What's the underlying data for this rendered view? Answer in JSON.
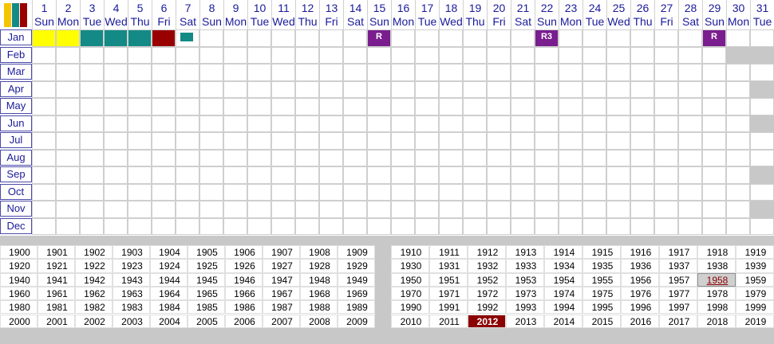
{
  "header": {
    "days": [
      "1",
      "2",
      "3",
      "4",
      "5",
      "6",
      "7",
      "8",
      "9",
      "10",
      "11",
      "12",
      "13",
      "14",
      "15",
      "16",
      "17",
      "18",
      "19",
      "20",
      "21",
      "22",
      "23",
      "24",
      "25",
      "26",
      "27",
      "28",
      "29",
      "30",
      "31"
    ],
    "weekdays": [
      "Sun",
      "Mon",
      "Tue",
      "Wed",
      "Thu",
      "Fri",
      "Sat",
      "Sun",
      "Mon",
      "Tue",
      "Wed",
      "Thu",
      "Fri",
      "Sat",
      "Sun",
      "Mon",
      "Tue",
      "Wed",
      "Thu",
      "Fri",
      "Sat",
      "Sun",
      "Mon",
      "Tue",
      "Wed",
      "Thu",
      "Fri",
      "Sat",
      "Sun",
      "Mon",
      "Tue"
    ]
  },
  "months": [
    "Jan",
    "Feb",
    "Mar",
    "Apr",
    "May",
    "Jun",
    "Jul",
    "Aug",
    "Sep",
    "Oct",
    "Nov",
    "Dec"
  ],
  "colors": {
    "yellow": "#ffff00",
    "teal": "#138a86",
    "darkred": "#990000",
    "purple": "#7a1d8f",
    "label_blue": "#1a1a9a",
    "selected_year_bg": "#8b0000"
  },
  "jan_events": [
    {
      "day": 1,
      "color": "yellow"
    },
    {
      "day": 2,
      "color": "yellow"
    },
    {
      "day": 3,
      "color": "teal"
    },
    {
      "day": 4,
      "color": "teal"
    },
    {
      "day": 5,
      "color": "teal"
    },
    {
      "day": 6,
      "color": "darkred"
    },
    {
      "day": 7,
      "color": "teal",
      "small": true
    }
  ],
  "badges": [
    {
      "day": 15,
      "text": "R"
    },
    {
      "day": 22,
      "text": "R3"
    },
    {
      "day": 29,
      "text": "R"
    }
  ],
  "years_left": [
    [
      "1900",
      "1901",
      "1902",
      "1903",
      "1904",
      "1905",
      "1906",
      "1907",
      "1908",
      "1909"
    ],
    [
      "1920",
      "1921",
      "1922",
      "1923",
      "1924",
      "1925",
      "1926",
      "1927",
      "1928",
      "1929"
    ],
    [
      "1940",
      "1941",
      "1942",
      "1943",
      "1944",
      "1945",
      "1946",
      "1947",
      "1948",
      "1949"
    ],
    [
      "1960",
      "1961",
      "1962",
      "1963",
      "1964",
      "1965",
      "1966",
      "1967",
      "1968",
      "1969"
    ],
    [
      "1980",
      "1981",
      "1982",
      "1983",
      "1984",
      "1985",
      "1986",
      "1987",
      "1988",
      "1989"
    ],
    [
      "2000",
      "2001",
      "2002",
      "2003",
      "2004",
      "2005",
      "2006",
      "2007",
      "2008",
      "2009"
    ]
  ],
  "years_right": [
    [
      "1910",
      "1911",
      "1912",
      "1913",
      "1914",
      "1915",
      "1916",
      "1917",
      "1918",
      "1919"
    ],
    [
      "1930",
      "1931",
      "1932",
      "1933",
      "1934",
      "1935",
      "1936",
      "1937",
      "1938",
      "1939"
    ],
    [
      "1950",
      "1951",
      "1952",
      "1953",
      "1954",
      "1955",
      "1956",
      "1957",
      "1958",
      "1959"
    ],
    [
      "1970",
      "1971",
      "1972",
      "1973",
      "1974",
      "1975",
      "1976",
      "1977",
      "1978",
      "1979"
    ],
    [
      "1990",
      "1991",
      "1992",
      "1993",
      "1994",
      "1995",
      "1996",
      "1997",
      "1998",
      "1999"
    ],
    [
      "2010",
      "2011",
      "2012",
      "2013",
      "2014",
      "2015",
      "2016",
      "2017",
      "2018",
      "2019"
    ]
  ],
  "selected_year": "2012",
  "linked_year": "1958"
}
